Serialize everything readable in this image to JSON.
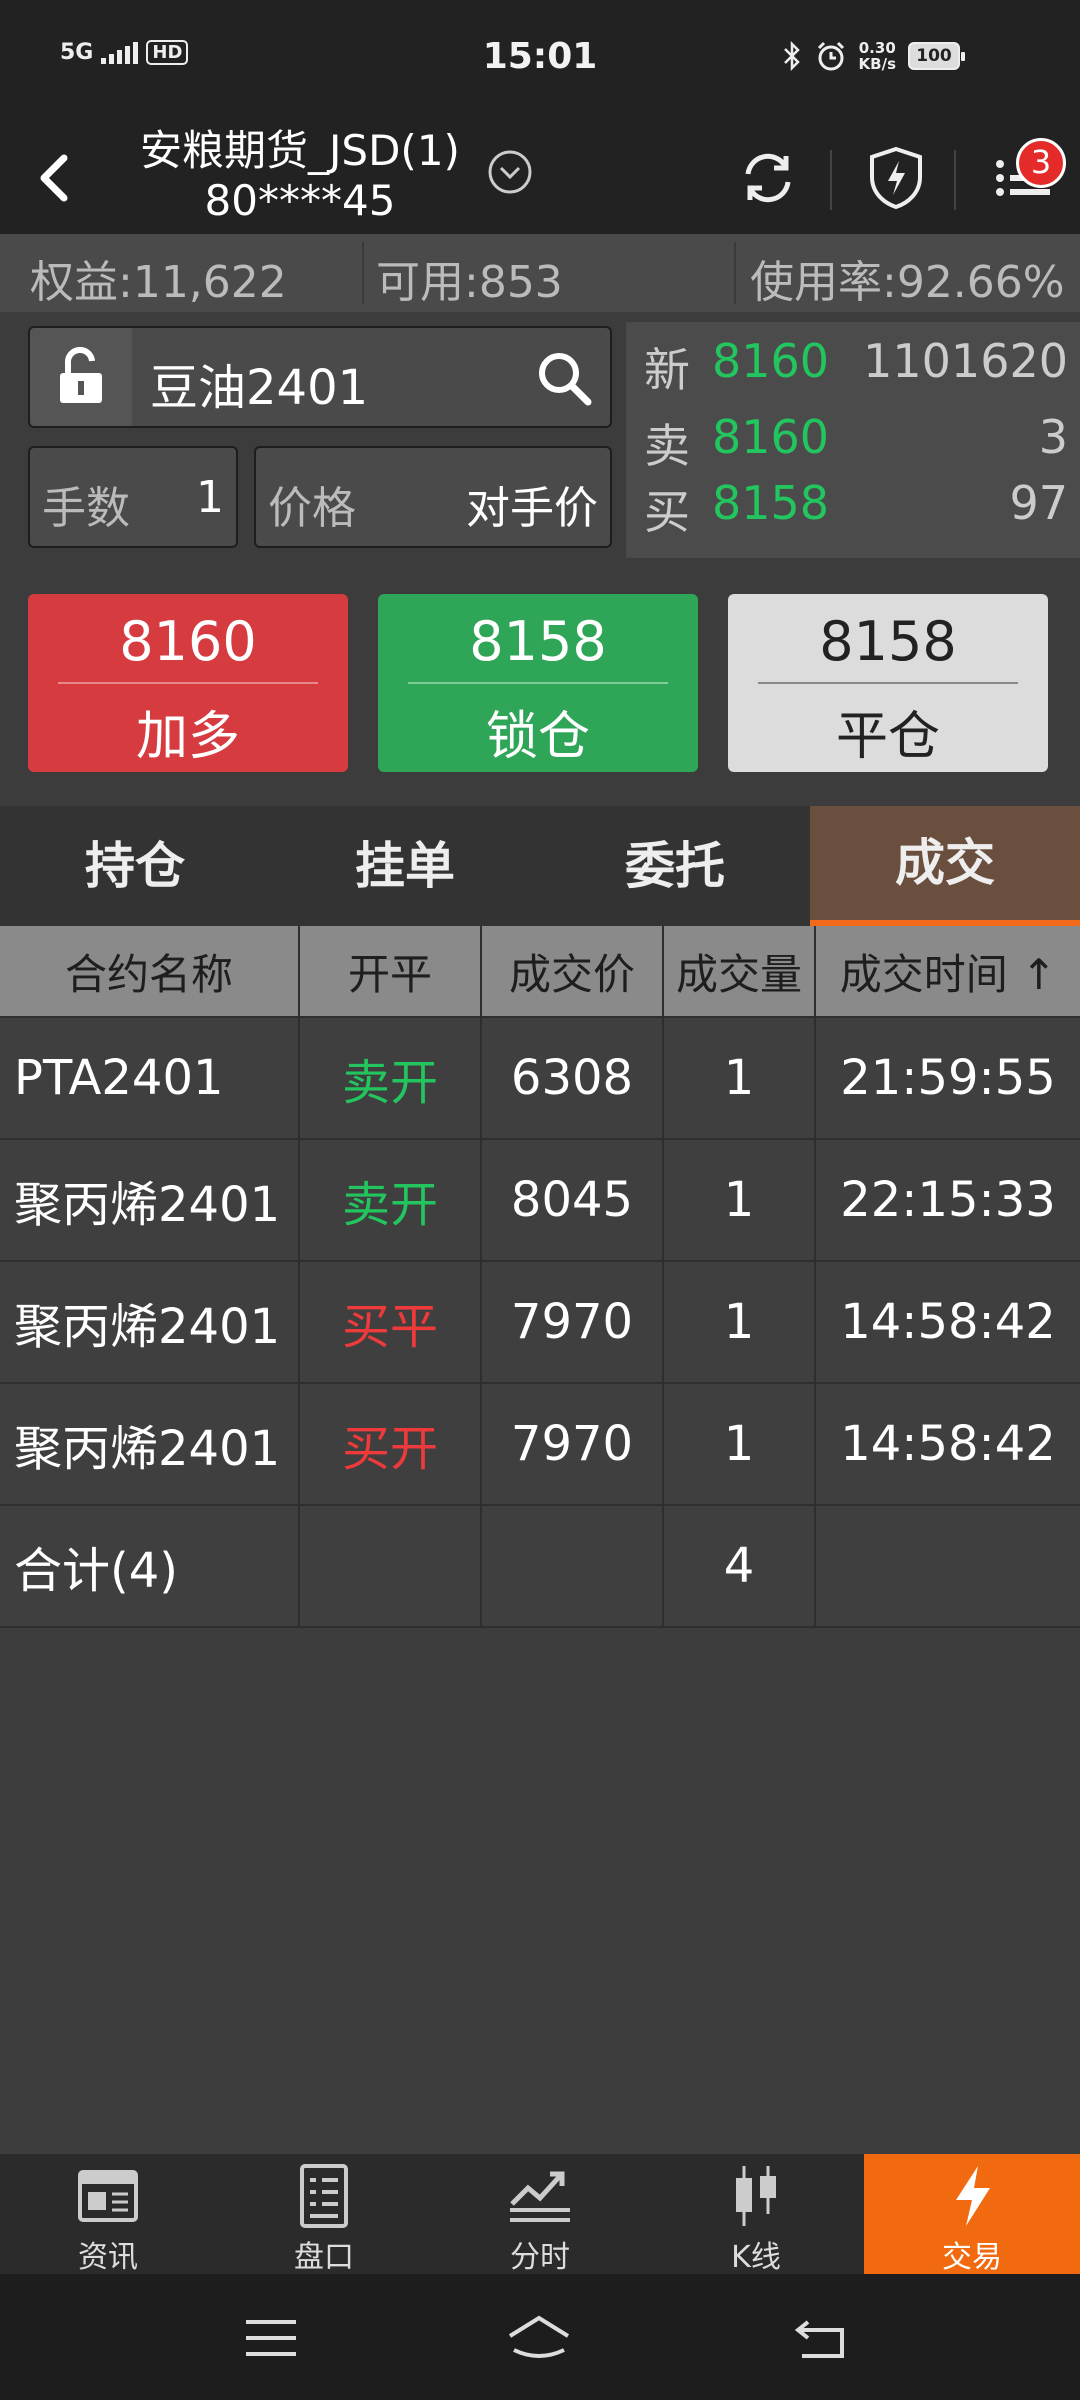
{
  "status_bar": {
    "network": "5G",
    "hd": "HD",
    "time": "15:01",
    "net_speed_value": "0.30",
    "net_speed_unit": "KB/s",
    "battery": "100"
  },
  "header": {
    "account_name": "安粮期货_JSD(1)",
    "account_id": "80****45",
    "notification_count": "3"
  },
  "summary": {
    "equity": "权益:11,622",
    "available": "可用:853",
    "usage": "使用率:92.66%"
  },
  "order": {
    "contract": "豆油2401",
    "lots_label": "手数",
    "lots_value": "1",
    "price_label": "价格",
    "price_value": "对手价"
  },
  "quote": {
    "last_label": "新",
    "last_price": "8160",
    "last_volume": "1101620",
    "ask_label": "卖",
    "ask_price": "8160",
    "ask_volume": "3",
    "bid_label": "买",
    "bid_price": "8158",
    "bid_volume": "97"
  },
  "actions": {
    "buy_price": "8160",
    "buy_label": "加多",
    "lock_price": "8158",
    "lock_label": "锁仓",
    "close_price": "8158",
    "close_label": "平仓"
  },
  "tabs": [
    {
      "label": "持仓"
    },
    {
      "label": "挂单"
    },
    {
      "label": "委托"
    },
    {
      "label": "成交"
    }
  ],
  "table": {
    "headers": [
      "合约名称",
      "开平",
      "成交价",
      "成交量",
      "成交时间 ↑"
    ],
    "rows": [
      {
        "contract": "PTA2401",
        "side": "卖开",
        "price": "6308",
        "volume": "1",
        "time": "21:59:55"
      },
      {
        "contract": "聚丙烯2401",
        "side": "卖开",
        "price": "8045",
        "volume": "1",
        "time": "22:15:33"
      },
      {
        "contract": "聚丙烯2401",
        "side": "买平",
        "price": "7970",
        "volume": "1",
        "time": "14:58:42"
      },
      {
        "contract": "聚丙烯2401",
        "side": "买开",
        "price": "7970",
        "volume": "1",
        "time": "14:58:42"
      }
    ],
    "total_label": "合计(4)",
    "total_volume": "4"
  },
  "bottom_nav": [
    {
      "label": "资讯",
      "icon": "news-icon"
    },
    {
      "label": "盘口",
      "icon": "orderbook-icon"
    },
    {
      "label": "分时",
      "icon": "intraday-chart-icon"
    },
    {
      "label": "K线",
      "icon": "candlestick-icon"
    },
    {
      "label": "交易",
      "icon": "lightning-icon"
    }
  ],
  "colors": {
    "buy_red": "#d63b40",
    "lock_green": "#2fa657",
    "active_tab": "#6a4f3e",
    "accent_orange": "#f26a0f",
    "price_green": "#22c55e",
    "buy_text_red": "#ee3a3a"
  }
}
